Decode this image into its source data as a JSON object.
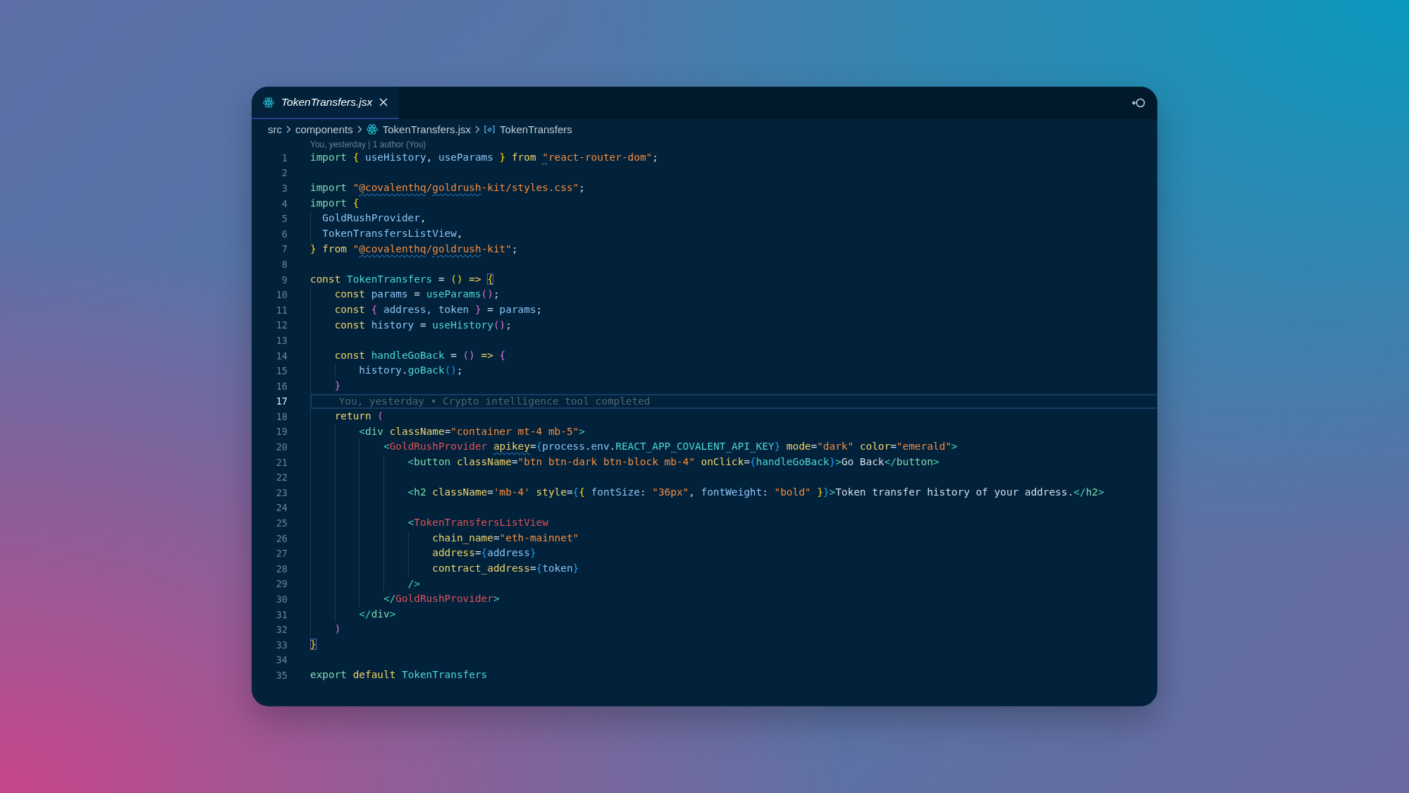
{
  "tabs": [
    {
      "label": "TokenTransfers.jsx",
      "selected": true
    }
  ],
  "breadcrumbs": [
    {
      "label": "src",
      "kind": "folder"
    },
    {
      "label": "components",
      "kind": "folder"
    },
    {
      "label": "TokenTransfers.jsx",
      "kind": "file"
    },
    {
      "label": "TokenTransfers",
      "kind": "symbol"
    }
  ],
  "blame_header": "You, yesterday | 1 author (You)",
  "lines": [
    {
      "number": "1",
      "selected": false,
      "tokens": [
        {
          "text": "import ",
          "kind": "keyword"
        },
        {
          "text": "{",
          "kind": "brace"
        },
        {
          "text": " useHistory",
          "kind": "variable"
        },
        {
          "text": ", ",
          "kind": "punctuation"
        },
        {
          "text": "useParams ",
          "kind": "variable"
        },
        {
          "text": "}",
          "kind": "brace"
        },
        {
          "text": " from ",
          "kind": "control"
        },
        {
          "text": "\"",
          "kind": "hinted"
        },
        {
          "text": "react-router-dom\"",
          "kind": "string"
        },
        {
          "text": ";",
          "kind": "punctuation"
        }
      ]
    },
    {
      "number": "2",
      "selected": false
    },
    {
      "number": "3",
      "selected": false,
      "tokens": [
        {
          "text": "import ",
          "kind": "keyword"
        },
        {
          "text": "\"",
          "kind": "string"
        },
        {
          "text": "@covalenthq",
          "kind": "flagged"
        },
        {
          "text": "/",
          "kind": "string"
        },
        {
          "text": "goldrush",
          "kind": "flagged"
        },
        {
          "text": "-kit/styles.css\"",
          "kind": "string"
        },
        {
          "text": ";",
          "kind": "punctuation"
        }
      ]
    },
    {
      "number": "4",
      "selected": false,
      "tokens": [
        {
          "text": "import ",
          "kind": "keyword"
        },
        {
          "text": "{",
          "kind": "brace"
        }
      ]
    },
    {
      "number": "5",
      "selected": false,
      "tokens": [
        {
          "text": "  GoldRushProvider",
          "kind": "variable"
        },
        {
          "text": ",",
          "kind": "punctuation"
        }
      ]
    },
    {
      "number": "6",
      "selected": false,
      "tokens": [
        {
          "text": "  TokenTransfersListView",
          "kind": "variable"
        },
        {
          "text": ",",
          "kind": "punctuation"
        }
      ]
    },
    {
      "number": "7",
      "selected": false,
      "tokens": [
        {
          "text": "}",
          "kind": "brace"
        },
        {
          "text": " from ",
          "kind": "control"
        },
        {
          "text": "\"",
          "kind": "string"
        },
        {
          "text": "@covalenthq",
          "kind": "flagged"
        },
        {
          "text": "/",
          "kind": "string"
        },
        {
          "text": "goldrush",
          "kind": "flagged"
        },
        {
          "text": "-kit\"",
          "kind": "string"
        },
        {
          "text": ";",
          "kind": "punctuation"
        }
      ]
    },
    {
      "number": "8",
      "selected": false
    },
    {
      "number": "9",
      "selected": false,
      "tokens": [
        {
          "text": "const ",
          "kind": "control"
        },
        {
          "text": "TokenTransfers",
          "kind": "function"
        },
        {
          "text": " = ",
          "kind": "punctuation"
        },
        {
          "text": "()",
          "kind": "brace"
        },
        {
          "text": " => ",
          "kind": "control"
        },
        {
          "text": "{",
          "kind": "matched"
        }
      ]
    },
    {
      "number": "10",
      "selected": false,
      "tokens": [
        {
          "text": "    const ",
          "kind": "control"
        },
        {
          "text": "params",
          "kind": "variable"
        },
        {
          "text": " = ",
          "kind": "punctuation"
        },
        {
          "text": "useParams",
          "kind": "function"
        },
        {
          "text": "()",
          "kind": "brace2"
        },
        {
          "text": ";",
          "kind": "punctuation"
        }
      ]
    },
    {
      "number": "11",
      "selected": false,
      "tokens": [
        {
          "text": "    const ",
          "kind": "control"
        },
        {
          "text": "{",
          "kind": "brace2"
        },
        {
          "text": " address, token ",
          "kind": "variable"
        },
        {
          "text": "}",
          "kind": "brace2"
        },
        {
          "text": " = ",
          "kind": "punctuation"
        },
        {
          "text": "params",
          "kind": "variable"
        },
        {
          "text": ";",
          "kind": "punctuation"
        }
      ]
    },
    {
      "number": "12",
      "selected": false,
      "tokens": [
        {
          "text": "    const ",
          "kind": "control"
        },
        {
          "text": "history",
          "kind": "variable"
        },
        {
          "text": " = ",
          "kind": "punctuation"
        },
        {
          "text": "useHistory",
          "kind": "function"
        },
        {
          "text": "()",
          "kind": "brace2"
        },
        {
          "text": ";",
          "kind": "punctuation"
        }
      ]
    },
    {
      "number": "13",
      "selected": false
    },
    {
      "number": "14",
      "selected": false,
      "tokens": [
        {
          "text": "    const ",
          "kind": "control"
        },
        {
          "text": "handleGoBack",
          "kind": "function"
        },
        {
          "text": " = ",
          "kind": "punctuation"
        },
        {
          "text": "()",
          "kind": "brace2"
        },
        {
          "text": " => ",
          "kind": "control"
        },
        {
          "text": "{",
          "kind": "brace2"
        }
      ]
    },
    {
      "number": "15",
      "selected": false,
      "tokens": [
        {
          "text": "        history",
          "kind": "variable"
        },
        {
          "text": ".",
          "kind": "punctuation"
        },
        {
          "text": "goBack",
          "kind": "function"
        },
        {
          "text": "()",
          "kind": "brace3"
        },
        {
          "text": ";",
          "kind": "punctuation"
        }
      ]
    },
    {
      "number": "16",
      "selected": false,
      "tokens": [
        {
          "text": "    }",
          "kind": "brace2"
        }
      ]
    },
    {
      "number": "17",
      "selected": true,
      "blame": "You, yesterday • Crypto intelligence tool completed"
    },
    {
      "number": "18",
      "selected": false,
      "tokens": [
        {
          "text": "    return ",
          "kind": "control"
        },
        {
          "text": "(",
          "kind": "brace2"
        }
      ]
    },
    {
      "number": "19",
      "selected": false,
      "tokens": [
        {
          "text": "        <",
          "kind": "bracket"
        },
        {
          "text": "div",
          "kind": "tag"
        },
        {
          "text": " className",
          "kind": "attribute"
        },
        {
          "text": "=",
          "kind": "punctuation"
        },
        {
          "text": "\"container mt-4 mb-5\"",
          "kind": "string"
        },
        {
          "text": ">",
          "kind": "bracket"
        }
      ]
    },
    {
      "number": "20",
      "selected": false,
      "tokens": [
        {
          "text": "            <",
          "kind": "bracket"
        },
        {
          "text": "GoldRushProvider ",
          "kind": "component"
        },
        {
          "text": "apikey",
          "kind": "flaggedattr"
        },
        {
          "text": "=",
          "kind": "punctuation"
        },
        {
          "text": "{",
          "kind": "brace3"
        },
        {
          "text": "process",
          "kind": "variable"
        },
        {
          "text": ".",
          "kind": "punctuation"
        },
        {
          "text": "env",
          "kind": "variable"
        },
        {
          "text": ".",
          "kind": "punctuation"
        },
        {
          "text": "REACT_APP_COVALENT_API_KEY",
          "kind": "function"
        },
        {
          "text": "}",
          "kind": "brace3"
        },
        {
          "text": " mode",
          "kind": "attribute"
        },
        {
          "text": "=",
          "kind": "punctuation"
        },
        {
          "text": "\"dark\"",
          "kind": "string"
        },
        {
          "text": " color",
          "kind": "attribute"
        },
        {
          "text": "=",
          "kind": "punctuation"
        },
        {
          "text": "\"emerald\"",
          "kind": "string"
        },
        {
          "text": ">",
          "kind": "bracket"
        }
      ]
    },
    {
      "number": "21",
      "selected": false,
      "tokens": [
        {
          "text": "                <",
          "kind": "bracket"
        },
        {
          "text": "button",
          "kind": "tag"
        },
        {
          "text": " className",
          "kind": "attribute"
        },
        {
          "text": "=",
          "kind": "punctuation"
        },
        {
          "text": "\"btn btn-dark btn-block mb-4\"",
          "kind": "string"
        },
        {
          "text": " onClick",
          "kind": "attribute"
        },
        {
          "text": "=",
          "kind": "punctuation"
        },
        {
          "text": "{",
          "kind": "brace3"
        },
        {
          "text": "handleGoBack",
          "kind": "function"
        },
        {
          "text": "}",
          "kind": "brace3"
        },
        {
          "text": ">",
          "kind": "bracket"
        },
        {
          "text": "Go Back",
          "kind": "text"
        },
        {
          "text": "</",
          "kind": "bracket"
        },
        {
          "text": "button",
          "kind": "tag"
        },
        {
          "text": ">",
          "kind": "bracket"
        }
      ]
    },
    {
      "number": "22",
      "selected": false
    },
    {
      "number": "23",
      "selected": false,
      "tokens": [
        {
          "text": "                <",
          "kind": "bracket"
        },
        {
          "text": "h2",
          "kind": "tag"
        },
        {
          "text": " className",
          "kind": "attribute"
        },
        {
          "text": "=",
          "kind": "punctuation"
        },
        {
          "text": "'mb-4'",
          "kind": "string"
        },
        {
          "text": " style",
          "kind": "attribute"
        },
        {
          "text": "=",
          "kind": "punctuation"
        },
        {
          "text": "{",
          "kind": "brace3"
        },
        {
          "text": "{",
          "kind": "brace"
        },
        {
          "text": " fontSize",
          "kind": "variable"
        },
        {
          "text": ": ",
          "kind": "punctuation"
        },
        {
          "text": "\"36px\"",
          "kind": "string"
        },
        {
          "text": ", ",
          "kind": "punctuation"
        },
        {
          "text": "fontWeight",
          "kind": "variable"
        },
        {
          "text": ": ",
          "kind": "punctuation"
        },
        {
          "text": "\"bold\" ",
          "kind": "string"
        },
        {
          "text": "}",
          "kind": "brace"
        },
        {
          "text": "}",
          "kind": "brace3"
        },
        {
          "text": ">",
          "kind": "bracket"
        },
        {
          "text": "Token transfer history of your address.",
          "kind": "text"
        },
        {
          "text": "</",
          "kind": "bracket"
        },
        {
          "text": "h2",
          "kind": "tag"
        },
        {
          "text": ">",
          "kind": "bracket"
        }
      ]
    },
    {
      "number": "24",
      "selected": false
    },
    {
      "number": "25",
      "selected": false,
      "tokens": [
        {
          "text": "                <",
          "kind": "bracket"
        },
        {
          "text": "TokenTransfersListView",
          "kind": "component"
        }
      ]
    },
    {
      "number": "26",
      "selected": false,
      "tokens": [
        {
          "text": "                    chain_name",
          "kind": "attribute"
        },
        {
          "text": "=",
          "kind": "punctuation"
        },
        {
          "text": "\"eth-mainnet\"",
          "kind": "string"
        }
      ]
    },
    {
      "number": "27",
      "selected": false,
      "tokens": [
        {
          "text": "                    address",
          "kind": "attribute"
        },
        {
          "text": "=",
          "kind": "punctuation"
        },
        {
          "text": "{",
          "kind": "brace3"
        },
        {
          "text": "address",
          "kind": "variable"
        },
        {
          "text": "}",
          "kind": "brace3"
        }
      ]
    },
    {
      "number": "28",
      "selected": false,
      "tokens": [
        {
          "text": "                    contract_address",
          "kind": "attribute"
        },
        {
          "text": "=",
          "kind": "punctuation"
        },
        {
          "text": "{",
          "kind": "brace3"
        },
        {
          "text": "token",
          "kind": "variable"
        },
        {
          "text": "}",
          "kind": "brace3"
        }
      ]
    },
    {
      "number": "29",
      "selected": false,
      "tokens": [
        {
          "text": "                />",
          "kind": "bracket"
        }
      ]
    },
    {
      "number": "30",
      "selected": false,
      "tokens": [
        {
          "text": "            </",
          "kind": "bracket"
        },
        {
          "text": "GoldRushProvider",
          "kind": "component"
        },
        {
          "text": ">",
          "kind": "bracket"
        }
      ]
    },
    {
      "number": "31",
      "selected": false,
      "tokens": [
        {
          "text": "        </",
          "kind": "bracket"
        },
        {
          "text": "div",
          "kind": "tag"
        },
        {
          "text": ">",
          "kind": "bracket"
        }
      ]
    },
    {
      "number": "32",
      "selected": false,
      "tokens": [
        {
          "text": "    )",
          "kind": "brace2"
        }
      ]
    },
    {
      "number": "33",
      "selected": false,
      "tokens": [
        {
          "text": "}",
          "kind": "matched"
        }
      ]
    },
    {
      "number": "34",
      "selected": false
    },
    {
      "number": "35",
      "selected": false,
      "tokens": [
        {
          "text": "export ",
          "kind": "keyword"
        },
        {
          "text": "default ",
          "kind": "control"
        },
        {
          "text": "TokenTransfers",
          "kind": "function"
        }
      ]
    }
  ]
}
